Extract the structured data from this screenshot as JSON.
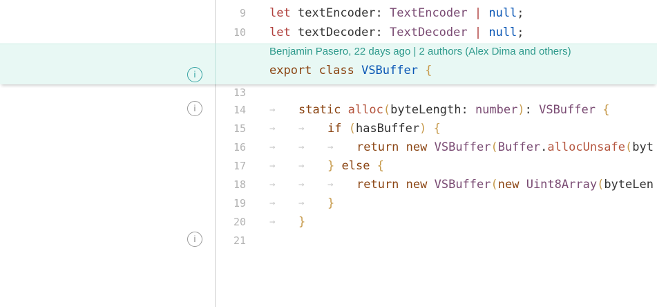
{
  "editor": {
    "lines": [
      {
        "number": "9",
        "tokens": [
          {
            "t": "let ",
            "c": "tok-red"
          },
          {
            "t": "textEncoder",
            "c": "tok-plain"
          },
          {
            "t": ": ",
            "c": "tok-plain"
          },
          {
            "t": "TextEncoder",
            "c": "tok-type"
          },
          {
            "t": " | ",
            "c": "tok-red"
          },
          {
            "t": "null",
            "c": "tok-null"
          },
          {
            "t": ";",
            "c": "tok-plain"
          }
        ]
      },
      {
        "number": "10",
        "tokens": [
          {
            "t": "let ",
            "c": "tok-red"
          },
          {
            "t": "textDecoder",
            "c": "tok-plain"
          },
          {
            "t": ": ",
            "c": "tok-plain"
          },
          {
            "t": "TextDecoder",
            "c": "tok-type"
          },
          {
            "t": " | ",
            "c": "tok-red"
          },
          {
            "t": "null",
            "c": "tok-null"
          },
          {
            "t": ";",
            "c": "tok-plain"
          }
        ]
      },
      {
        "number": "13",
        "tokens": []
      },
      {
        "number": "14",
        "indent": 1,
        "tokens": [
          {
            "t": "static ",
            "c": "tok-kw2"
          },
          {
            "t": "alloc",
            "c": "tok-fn"
          },
          {
            "t": "(",
            "c": "tok-punct"
          },
          {
            "t": "byteLength",
            "c": "tok-plain"
          },
          {
            "t": ": ",
            "c": "tok-plain"
          },
          {
            "t": "number",
            "c": "tok-type"
          },
          {
            "t": ")",
            "c": "tok-punct"
          },
          {
            "t": ": ",
            "c": "tok-plain"
          },
          {
            "t": "VSBuffer",
            "c": "tok-type"
          },
          {
            "t": " {",
            "c": "tok-punct"
          }
        ]
      },
      {
        "number": "15",
        "indent": 2,
        "tokens": [
          {
            "t": "if ",
            "c": "tok-kw2"
          },
          {
            "t": "(",
            "c": "tok-punct"
          },
          {
            "t": "hasBuffer",
            "c": "tok-plain"
          },
          {
            "t": ") {",
            "c": "tok-punct"
          }
        ]
      },
      {
        "number": "16",
        "indent": 3,
        "tokens": [
          {
            "t": "return ",
            "c": "tok-kw2"
          },
          {
            "t": "new ",
            "c": "tok-kw2"
          },
          {
            "t": "VSBuffer",
            "c": "tok-type"
          },
          {
            "t": "(",
            "c": "tok-punct"
          },
          {
            "t": "Buffer",
            "c": "tok-type"
          },
          {
            "t": ".",
            "c": "tok-plain"
          },
          {
            "t": "allocUnsafe",
            "c": "tok-fn"
          },
          {
            "t": "(",
            "c": "tok-punct"
          },
          {
            "t": "byt",
            "c": "tok-plain"
          }
        ]
      },
      {
        "number": "17",
        "indent": 2,
        "tokens": [
          {
            "t": "} ",
            "c": "tok-punct"
          },
          {
            "t": "else ",
            "c": "tok-kw2"
          },
          {
            "t": "{",
            "c": "tok-punct"
          }
        ]
      },
      {
        "number": "18",
        "indent": 3,
        "tokens": [
          {
            "t": "return ",
            "c": "tok-kw2"
          },
          {
            "t": "new ",
            "c": "tok-kw2"
          },
          {
            "t": "VSBuffer",
            "c": "tok-type"
          },
          {
            "t": "(",
            "c": "tok-punct"
          },
          {
            "t": "new ",
            "c": "tok-kw2"
          },
          {
            "t": "Uint8Array",
            "c": "tok-type"
          },
          {
            "t": "(",
            "c": "tok-punct"
          },
          {
            "t": "byteLen",
            "c": "tok-plain"
          }
        ]
      },
      {
        "number": "19",
        "indent": 2,
        "tokens": [
          {
            "t": "}",
            "c": "tok-punct"
          }
        ]
      },
      {
        "number": "20",
        "indent": 1,
        "tokens": [
          {
            "t": "}",
            "c": "tok-punct"
          }
        ]
      },
      {
        "number": "21",
        "tokens": []
      }
    ],
    "sticky": {
      "blame": "Benjamin Pasero, 22 days ago | 2 authors (Alex Dima and others)",
      "code": [
        {
          "t": "export ",
          "c": "tok-kw2"
        },
        {
          "t": "class ",
          "c": "tok-kw2"
        },
        {
          "t": "VSBuffer",
          "c": "tok-class"
        },
        {
          "t": " {",
          "c": "tok-punct"
        }
      ]
    },
    "indent_glyph": "→",
    "info_glyph": "i"
  },
  "colors": {
    "sticky_background": "#e8f8f4",
    "blame_text": "#2e9a8c",
    "info_active": "#36a3a3"
  }
}
